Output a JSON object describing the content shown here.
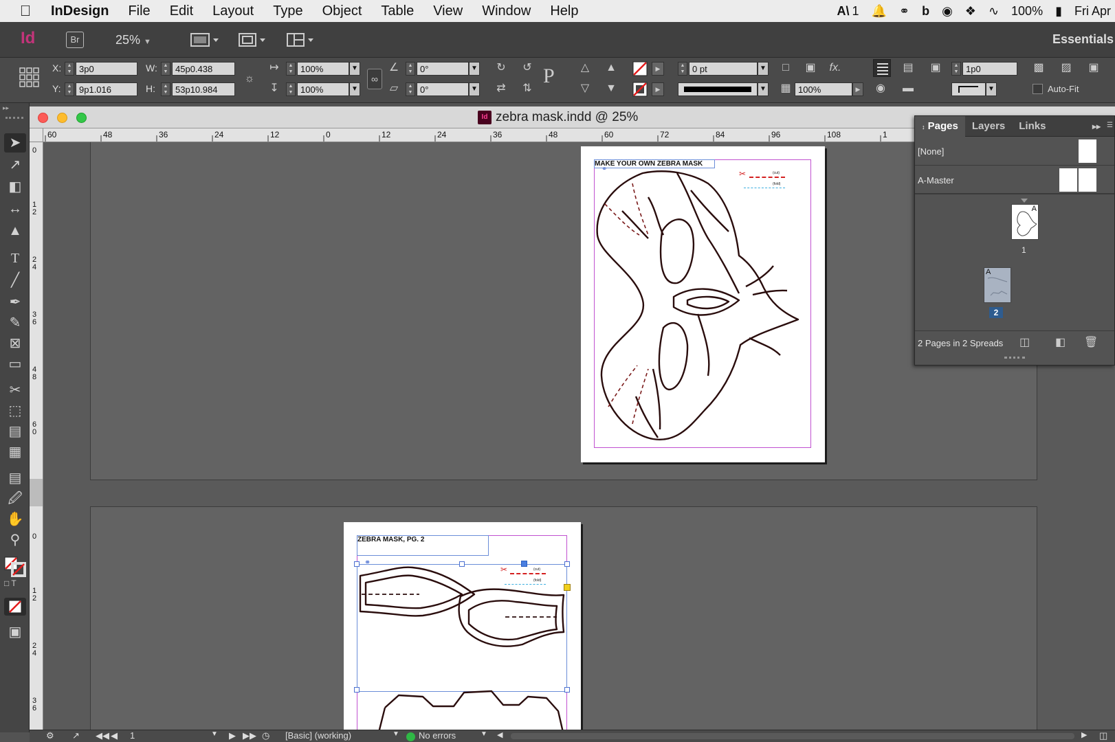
{
  "menubar": {
    "app": "InDesign",
    "items": [
      "File",
      "Edit",
      "Layout",
      "Type",
      "Object",
      "Table",
      "View",
      "Window",
      "Help"
    ],
    "status": {
      "adobe_count": "1",
      "battery": "100%",
      "clock": "Fri Apr"
    }
  },
  "appbar": {
    "logo": "Id",
    "bridge": "Br",
    "zoom": "25%",
    "workspace": "Essentials"
  },
  "control": {
    "x_label": "X:",
    "x": "3p0",
    "y_label": "Y:",
    "y": "9p1.016",
    "w_label": "W:",
    "w": "45p0.438",
    "h_label": "H:",
    "h": "53p10.984",
    "scale_x": "100%",
    "scale_y": "100%",
    "rotate": "0°",
    "shear": "0°",
    "stroke_weight": "0 pt",
    "opacity": "100%",
    "offset": "1p0",
    "auto_fit": "Auto-Fit"
  },
  "document": {
    "title": "zebra mask.indd @ 25%",
    "ruler_h": [
      "60",
      "48",
      "36",
      "24",
      "12",
      "0",
      "12",
      "24",
      "36",
      "48",
      "60",
      "72",
      "84",
      "96",
      "108",
      "1"
    ],
    "ruler_v_top": [
      "0",
      "12",
      "24",
      "36",
      "48",
      "60"
    ],
    "ruler_v_bottom": [
      "0",
      "12",
      "24",
      "36"
    ],
    "page1_heading": "MAKE YOUR OWN ZEBRA MASK",
    "page2_heading": "ZEBRA MASK, PG. 2",
    "legend_cut": "(cut)",
    "legend_fold": "(fold)"
  },
  "pages_panel": {
    "tabs": [
      "Pages",
      "Layers",
      "Links"
    ],
    "none": "[None]",
    "master": "A-Master",
    "page1_num": "1",
    "page2_num": "2",
    "master_badge": "A",
    "summary": "2 Pages in 2 Spreads"
  },
  "status": {
    "page": "1",
    "style": "[Basic] (working)",
    "preflight": "No errors"
  },
  "colors": {
    "accent": "#c3347a",
    "frame_magenta": "#c050d0",
    "guide_blue": "#6a8dd8",
    "error_green": "#2fb845"
  }
}
